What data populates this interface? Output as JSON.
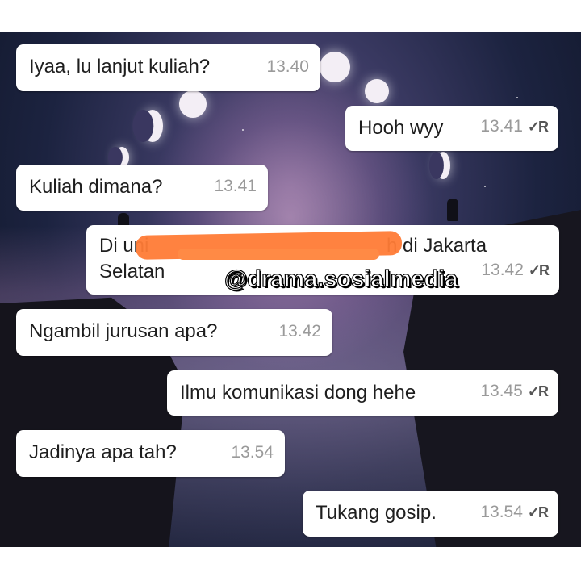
{
  "messages": [
    {
      "text": "Iyaa, lu lanjut kuliah?",
      "time": "13.40"
    },
    {
      "text": "Hooh wyy",
      "time": "13.41",
      "receipt": "✓R"
    },
    {
      "text": "Kuliah dimana?",
      "time": "13.41"
    },
    {
      "line1": "Di uni",
      "line1b": "h di Jakarta",
      "line2": "Selatan",
      "time": "13.42",
      "receipt": "✓R"
    },
    {
      "text": "Ngambil jurusan apa?",
      "time": "13.42"
    },
    {
      "text": "Ilmu komunikasi dong hehe",
      "time": "13.45",
      "receipt": "✓R"
    },
    {
      "text": "Jadinya apa tah?",
      "time": "13.54"
    },
    {
      "text": "Tukang gosip.",
      "time": "13.54",
      "receipt": "✓R"
    }
  ],
  "watermark": "@drama.sosialmedia",
  "colors": {
    "bubble": "#ffffff",
    "redaction": "#ff7b36",
    "time": "#9a9a9a"
  }
}
